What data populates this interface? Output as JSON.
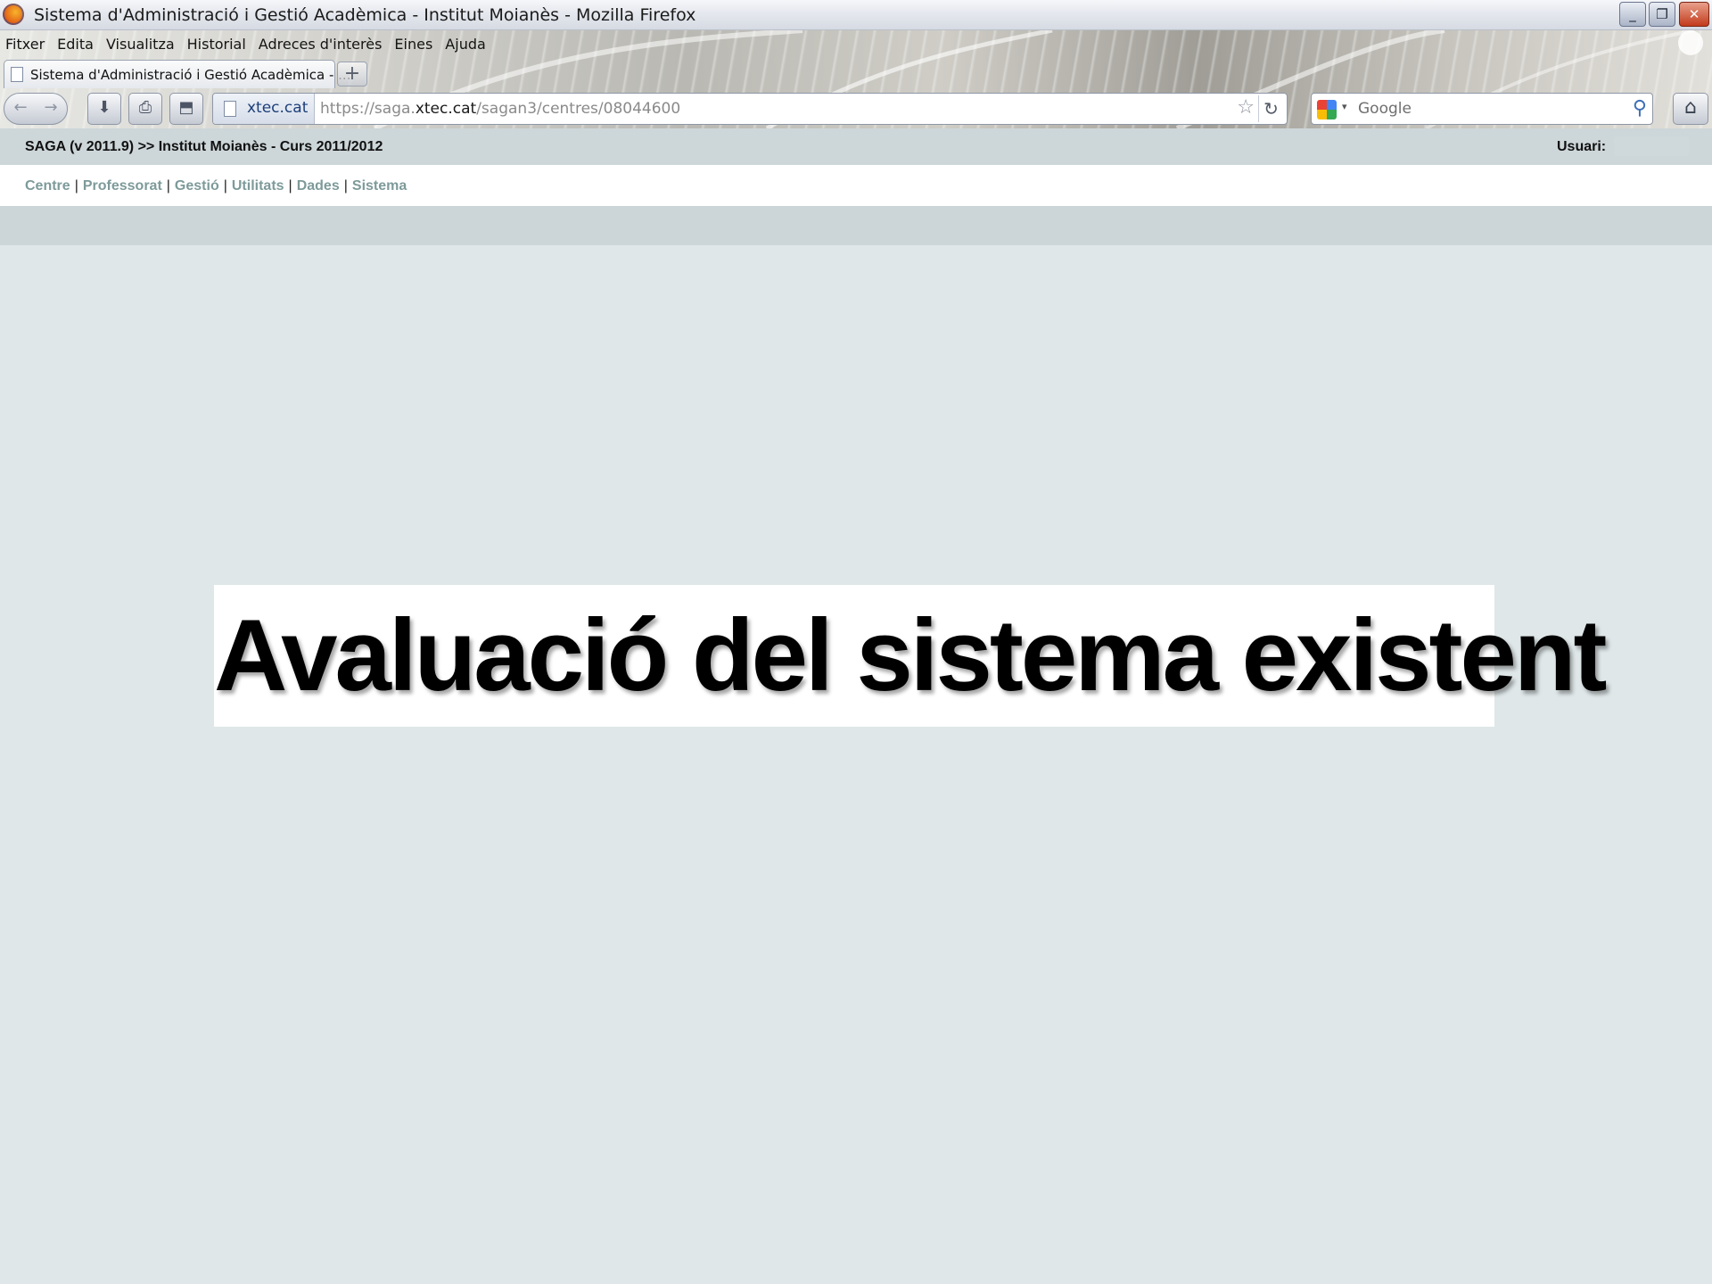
{
  "window": {
    "title": "Sistema d'Administració i Gestió Acadèmica - Institut Moianès - Mozilla Firefox",
    "controls": {
      "minimize": "_",
      "restore": "❐",
      "close": "✕"
    }
  },
  "menubar": {
    "items": [
      "Fitxer",
      "Edita",
      "Visualitza",
      "Historial",
      "Adreces d'interès",
      "Eines",
      "Ajuda"
    ]
  },
  "tabs": [
    {
      "label": "Sistema d'Administració i Gestió Acadèmica - ...",
      "active": true
    }
  ],
  "tabstrip": {
    "new_tab": "+"
  },
  "navbar": {
    "back": "←",
    "forward": "→",
    "download": "⬇",
    "print": "⎙",
    "screenshot": "⬒",
    "identity": "xtec.cat",
    "url_prefix": "https://saga.",
    "url_domain": "xtec.cat",
    "url_suffix": "/sagan3/centres/08044600",
    "star": "☆",
    "reload": "↻",
    "home": "⌂"
  },
  "search": {
    "engine": "Google",
    "placeholder": "Google",
    "caret": "▾",
    "go": "⚲"
  },
  "saga": {
    "title": "SAGA (v 2011.9) >> Institut Moianès - Curs 2011/2012",
    "user_label": "Usuari:",
    "menu": [
      "Centre",
      "Professorat",
      "Gestió",
      "Utilitats",
      "Dades",
      "Sistema"
    ],
    "separator": "|"
  },
  "overlay": {
    "heading": "Avaluació del sistema existent"
  },
  "colors": {
    "page_bg": "#dfe7e8",
    "header_bg": "#cdd6d8",
    "menu_link": "#7e9a9a"
  }
}
